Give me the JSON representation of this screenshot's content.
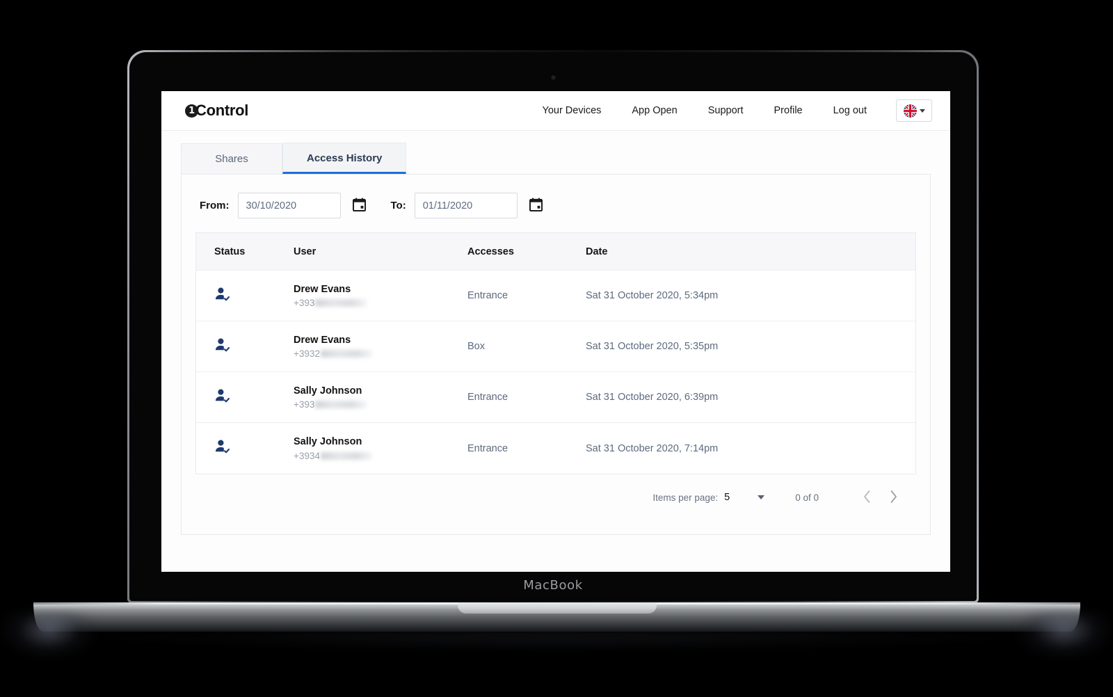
{
  "device": {
    "brand_label": "MacBook"
  },
  "navbar": {
    "logo_mark": "1",
    "logo_text": "Control",
    "links": [
      {
        "label": "Your Devices",
        "name": "your-devices"
      },
      {
        "label": "App Open",
        "name": "app-open"
      },
      {
        "label": "Support",
        "name": "support"
      },
      {
        "label": "Profile",
        "name": "profile"
      },
      {
        "label": "Log out",
        "name": "log-out"
      }
    ],
    "language": {
      "flag": "uk-flag-icon",
      "caret": "chevron-down-icon"
    }
  },
  "tabs": [
    {
      "label": "Shares",
      "active": false
    },
    {
      "label": "Access History",
      "active": true
    }
  ],
  "filters": {
    "from_label": "From:",
    "from_value": "30/10/2020",
    "from_placeholder": "dd/mm/yyyy",
    "to_label": "To:",
    "to_value": "01/11/2020",
    "to_placeholder": "dd/mm/yyyy",
    "calendar_icon": "calendar-icon"
  },
  "table": {
    "columns": [
      "Status",
      "User",
      "Accesses",
      "Date"
    ],
    "rows": [
      {
        "status_icon": "user-verified-icon",
        "user_name": "Drew Evans",
        "user_phone_prefix": "+393",
        "user_phone_masked": true,
        "access": "Entrance",
        "date": "Sat 31 October 2020, 5:34pm"
      },
      {
        "status_icon": "user-verified-icon",
        "user_name": "Drew Evans",
        "user_phone_prefix": "+3932",
        "user_phone_masked": true,
        "access": "Box",
        "date": "Sat 31 October 2020, 5:35pm"
      },
      {
        "status_icon": "user-verified-icon",
        "user_name": "Sally Johnson",
        "user_phone_prefix": "+393",
        "user_phone_masked": true,
        "access": "Entrance",
        "date": "Sat 31 October 2020, 6:39pm"
      },
      {
        "status_icon": "user-verified-icon",
        "user_name": "Sally Johnson",
        "user_phone_prefix": "+3934",
        "user_phone_masked": true,
        "access": "Entrance",
        "date": "Sat 31 October 2020, 7:14pm"
      }
    ]
  },
  "paginator": {
    "items_per_page_label": "Items per page:",
    "items_per_page_value": "5",
    "range_label": "0 of 0",
    "prev_icon": "chevron-left-icon",
    "next_icon": "chevron-right-icon"
  },
  "colors": {
    "accent": "#1d6fd6",
    "status_icon": "#1f3a6e",
    "muted_text": "#5d6a7e"
  }
}
